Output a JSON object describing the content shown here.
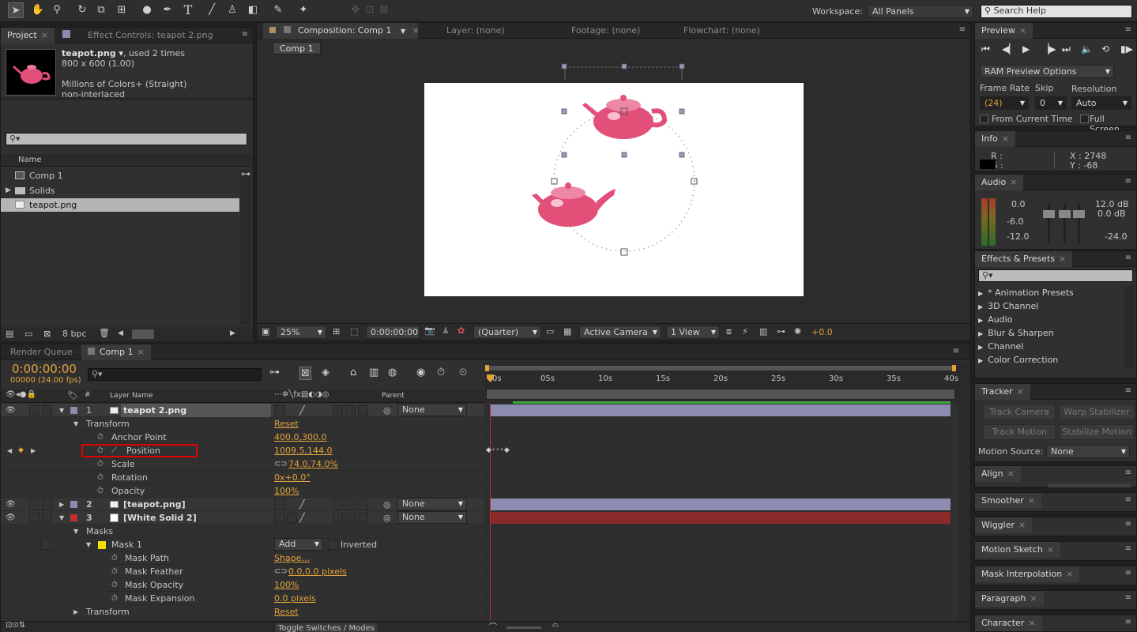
{
  "toolbar": {
    "workspace_label": "Workspace:",
    "workspace_value": "All Panels",
    "search_placeholder": "Search Help"
  },
  "project": {
    "tab_project": "Project",
    "tab_effect_controls": "Effect Controls: teapot 2.png",
    "file_name": "teapot.png ▾",
    "file_used": ", used 2 times",
    "file_dims": "800 x 600 (1.00)",
    "file_colors": "Millions of Colors+ (Straight)",
    "file_interlace": "non-interlaced",
    "col_name": "Name",
    "items": [
      "Comp 1",
      "Solids",
      "teapot.png"
    ],
    "bpc": "8 bpc"
  },
  "comp": {
    "tab_comp": "Composition: Comp 1",
    "tab_layer": "Layer: (none)",
    "tab_footage": "Footage: (none)",
    "tab_flowchart": "Flowchart: (none)",
    "crumb": "Comp 1",
    "zoom": "25%",
    "timecode": "0:00:00:00",
    "resolution": "(Quarter)",
    "camera": "Active Camera",
    "view": "1 View",
    "exposure": "+0.0"
  },
  "preview": {
    "tab": "Preview",
    "ram_options": "RAM Preview Options",
    "frame_rate_label": "Frame Rate",
    "skip_label": "Skip",
    "resolution_label": "Resolution",
    "frame_rate": "(24)",
    "skip": "0",
    "resolution": "Auto",
    "from_current": "From Current Time",
    "full_screen": "Full Screen"
  },
  "info": {
    "tab": "Info",
    "r": "R :",
    "g": "G :",
    "x": "X : 2748",
    "y": "Y : -68"
  },
  "audio": {
    "tab": "Audio",
    "left_levels": [
      "0.0",
      "-6.0",
      "-12.0"
    ],
    "right_levels": [
      "12.0 dB",
      "0.0 dB",
      "-24.0"
    ]
  },
  "effects": {
    "tab": "Effects & Presets",
    "items": [
      "* Animation Presets",
      "3D Channel",
      "Audio",
      "Blur & Sharpen",
      "Channel",
      "Color Correction"
    ]
  },
  "tracker": {
    "tab": "Tracker",
    "track_camera": "Track Camera",
    "warp_stabilizer": "Warp Stabilizer",
    "track_motion": "Track Motion",
    "stabilize_motion": "Stabilize Motion",
    "motion_source_label": "Motion Source:",
    "motion_source": "None"
  },
  "side_tabs": [
    "Align",
    "Smoother",
    "Wiggler",
    "Motion Sketch",
    "Mask Interpolation",
    "Paragraph",
    "Character"
  ],
  "timeline": {
    "tab_render": "Render Queue",
    "tab_comp": "Comp 1",
    "timecode": "0:00:00:00",
    "fps": "00000 (24.00 fps)",
    "col_layer_name": "Layer Name",
    "col_parent": "Parent",
    "ruler": [
      "0s",
      "05s",
      "10s",
      "15s",
      "20s",
      "25s",
      "30s",
      "35s",
      "40s"
    ],
    "toggle": "Toggle Switches / Modes",
    "layers": [
      {
        "num": "1",
        "name": "teapot 2.png",
        "parent": "None"
      },
      {
        "num": "2",
        "name": "[teapot.png]",
        "parent": "None"
      },
      {
        "num": "3",
        "name": "[White Solid 2]",
        "parent": "None"
      }
    ],
    "props": {
      "transform": "Transform",
      "reset": "Reset",
      "anchor_label": "Anchor Point",
      "anchor_value": "400.0,300.0",
      "position_label": "Position",
      "position_value": "1009.5,144.0",
      "scale_label": "Scale",
      "scale_value": "74.0,74.0%",
      "rotation_label": "Rotation",
      "rotation_value": "0x+0.0°",
      "opacity_label": "Opacity",
      "opacity_value": "100%",
      "masks": "Masks",
      "mask1": "Mask 1",
      "mask_mode": "Add",
      "inverted": "Inverted",
      "mask_path_label": "Mask Path",
      "mask_path_value": "Shape...",
      "mask_feather_label": "Mask Feather",
      "mask_feather_value": "0.0,0.0 pixels",
      "mask_opacity_label": "Mask Opacity",
      "mask_opacity_value": "100%",
      "mask_expansion_label": "Mask Expansion",
      "mask_expansion_value": "0.0 pixels",
      "transform2": "Transform",
      "reset2": "Reset"
    }
  },
  "colors": {
    "accent": "#e2a23a",
    "layer_lavender": "#8c8cb0",
    "solid_red": "#8a2a2a",
    "highlight_box": "#e00000",
    "work_area": "#3fa83f"
  }
}
